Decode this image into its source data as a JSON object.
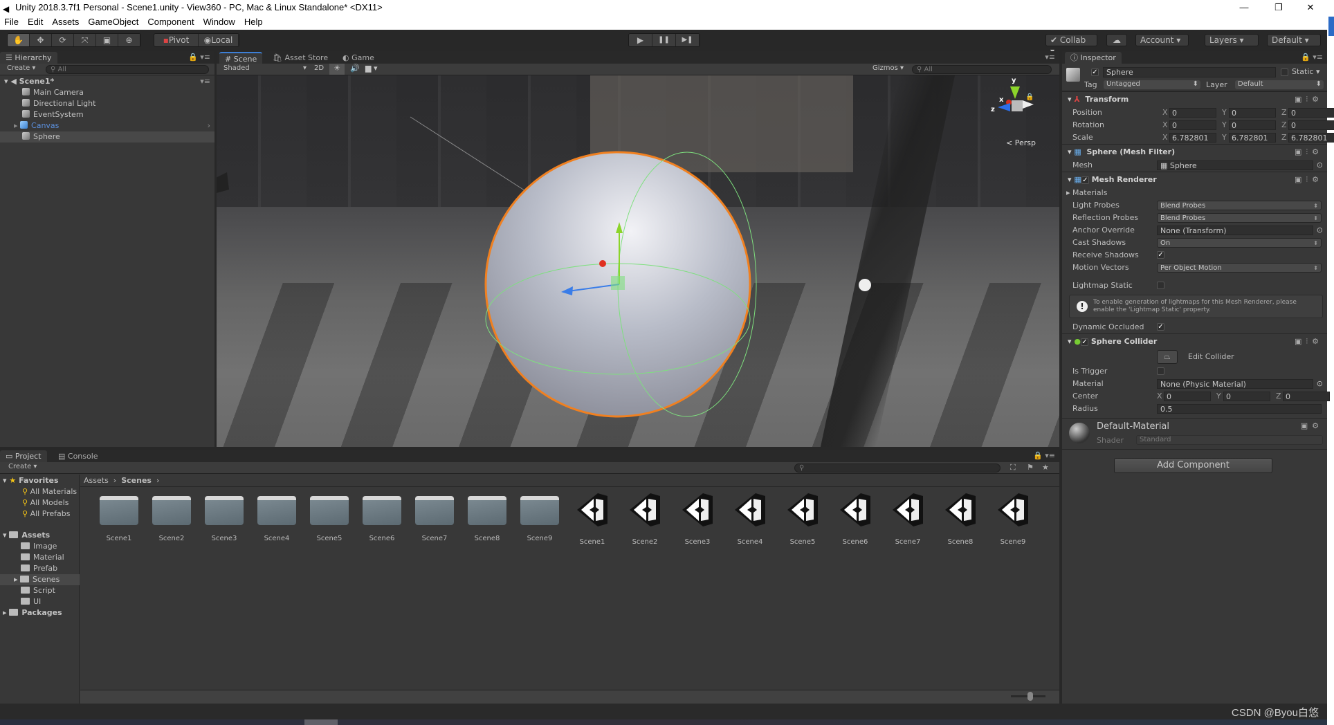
{
  "window": {
    "title": "Unity 2018.3.7f1 Personal - Scene1.unity - View360 - PC, Mac & Linux Standalone* <DX11>",
    "minimize": "—",
    "restore": "❐",
    "close": "✕"
  },
  "menu": [
    "File",
    "Edit",
    "Assets",
    "GameObject",
    "Component",
    "Window",
    "Help"
  ],
  "toolbar": {
    "tools": [
      "hand-tool",
      "move-tool",
      "rotate-tool",
      "scale-tool",
      "rect-tool",
      "transform-tool"
    ],
    "tool_glyphs": [
      "✋",
      "✥",
      "⟳",
      "⤧",
      "▣",
      "⊕"
    ],
    "pivot": "Pivot",
    "local": "Local",
    "play": "▶",
    "pause": "❚❚",
    "step": "▶❚",
    "collab": "Collab",
    "cloud": "☁",
    "account": "Account",
    "layers": "Layers",
    "layout": "Default"
  },
  "hierarchy": {
    "tab": "Hierarchy",
    "create": "Create",
    "search_placeholder": "All",
    "scene": "Scene1*",
    "items": [
      "Main Camera",
      "Directional Light",
      "EventSystem",
      "Canvas",
      "Sphere"
    ],
    "selected": "Sphere"
  },
  "scene": {
    "tabs": [
      "Scene",
      "Asset Store",
      "Game"
    ],
    "shading": "Shaded",
    "mode_2d": "2D",
    "gizmos": "Gizmos",
    "search_placeholder": "All",
    "persp": "< Persp",
    "axis_y": "y",
    "axis_x": "x",
    "axis_z": "z"
  },
  "inspector": {
    "tab": "Inspector",
    "object_name": "Sphere",
    "static_label": "Static",
    "tag_label": "Tag",
    "tag": "Untagged",
    "layer_label": "Layer",
    "layer": "Default",
    "transform": {
      "title": "Transform",
      "position_label": "Position",
      "rotation_label": "Rotation",
      "scale_label": "Scale",
      "position": [
        "0",
        "0",
        "0"
      ],
      "rotation": [
        "0",
        "0",
        "0"
      ],
      "scale": [
        "6.782801",
        "6.782801",
        "6.782801"
      ]
    },
    "mesh_filter": {
      "title": "Sphere (Mesh Filter)",
      "mesh_label": "Mesh",
      "mesh": "Sphere"
    },
    "mesh_renderer": {
      "title": "Mesh Renderer",
      "materials": "Materials",
      "light_probes_label": "Light Probes",
      "light_probes": "Blend Probes",
      "reflection_probes_label": "Reflection Probes",
      "reflection_probes": "Blend Probes",
      "anchor_label": "Anchor Override",
      "anchor": "None (Transform)",
      "cast_label": "Cast Shadows",
      "cast": "On",
      "receive_label": "Receive Shadows",
      "motion_label": "Motion Vectors",
      "motion": "Per Object Motion",
      "lightmap_label": "Lightmap Static",
      "help": "To enable generation of lightmaps for this Mesh Renderer, please enable the 'Lightmap Static' property.",
      "dynamic_label": "Dynamic Occluded"
    },
    "sphere_collider": {
      "title": "Sphere Collider",
      "edit": "Edit Collider",
      "trigger_label": "Is Trigger",
      "material_label": "Material",
      "material": "None (Physic Material)",
      "center_label": "Center",
      "center": [
        "0",
        "0",
        "0"
      ],
      "radius_label": "Radius",
      "radius": "0.5"
    },
    "material": {
      "name": "Default-Material",
      "shader_label": "Shader",
      "shader": "Standard"
    },
    "add_component": "Add Component"
  },
  "project": {
    "tabs": [
      "Project",
      "Console"
    ],
    "create": "Create",
    "favorites": "Favorites",
    "fav_items": [
      "All Materials",
      "All Models",
      "All Prefabs"
    ],
    "assets": "Assets",
    "asset_folders": [
      "Image",
      "Material",
      "Prefab",
      "Scenes",
      "Script",
      "UI"
    ],
    "packages": "Packages",
    "breadcrumb": [
      "Assets",
      "Scenes"
    ],
    "folders": [
      "Scene1",
      "Scene2",
      "Scene3",
      "Scene4",
      "Scene5",
      "Scene6",
      "Scene7",
      "Scene8",
      "Scene9"
    ],
    "scenes": [
      "Scene1",
      "Scene2",
      "Scene3",
      "Scene4",
      "Scene5",
      "Scene6",
      "Scene7",
      "Scene8",
      "Scene9"
    ]
  },
  "watermark": "CSDN @Byou白悠"
}
